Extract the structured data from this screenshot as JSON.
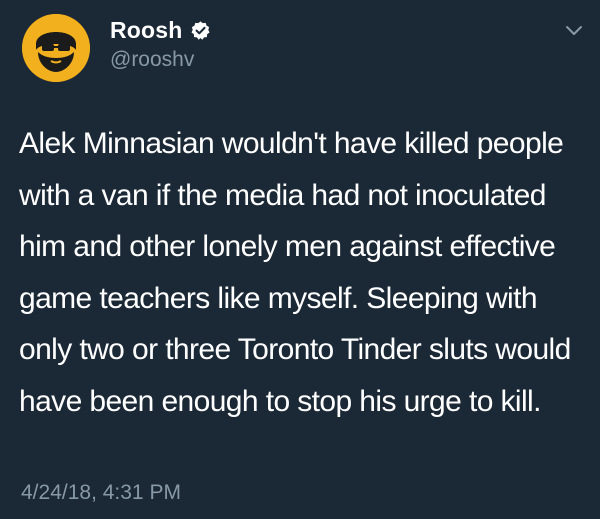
{
  "tweet": {
    "author": {
      "display_name": "Roosh",
      "handle": "@rooshv",
      "verified": true,
      "avatar_icon": "bearded-face-avatar",
      "avatar_color": "#f2b01e"
    },
    "text": "Alek Minnasian wouldn't have killed people with a van if the media had not inoculated him and other lonely men against effective game teachers like myself. Sleeping with only two or three Toronto Tinder sluts would have been enough to stop his urge to kill.",
    "timestamp": "4/24/18, 4:31 PM",
    "menu_icon": "chevron-down-icon"
  },
  "colors": {
    "background": "#1b2836",
    "primary_text": "#ffffff",
    "secondary_text": "#8899a6",
    "verified_badge": "#ffffff"
  }
}
